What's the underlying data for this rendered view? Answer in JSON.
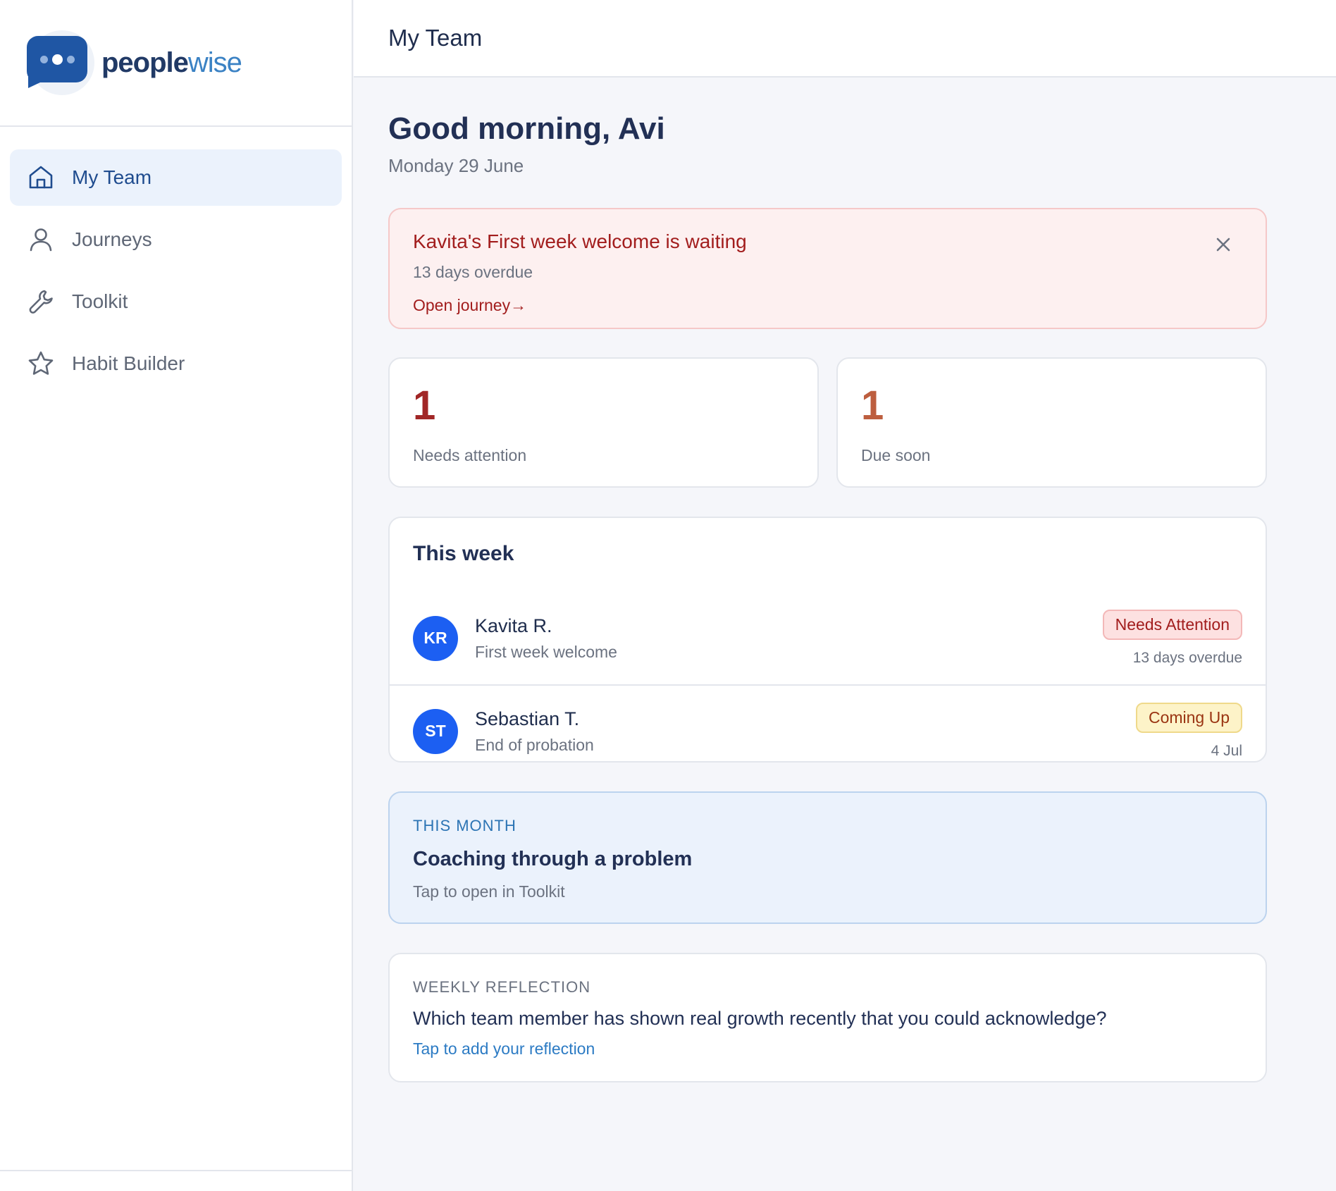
{
  "brand": {
    "name_part1": "people",
    "name_part2": "wise"
  },
  "sidebar": {
    "items": [
      {
        "label": "My Team",
        "icon": "home-icon",
        "active": true
      },
      {
        "label": "Journeys",
        "icon": "person-icon",
        "active": false
      },
      {
        "label": "Toolkit",
        "icon": "wrench-icon",
        "active": false
      },
      {
        "label": "Habit Builder",
        "icon": "star-icon",
        "active": false
      }
    ]
  },
  "header": {
    "title": "My Team"
  },
  "greeting": {
    "title": "Good morning, Avi",
    "date": "Monday 29 June"
  },
  "alert": {
    "title": "Kavita's First week welcome is waiting",
    "subtitle": "13 days overdue",
    "link": "Open journey→",
    "close_icon": "close-icon"
  },
  "stats": [
    {
      "value": "1",
      "label": "Needs attention",
      "color": "#a12626"
    },
    {
      "value": "1",
      "label": "Due soon",
      "color": "#bd5e3f"
    }
  ],
  "this_week": {
    "title": "This week",
    "rows": [
      {
        "initials": "KR",
        "name": "Kavita R.",
        "journey": "First week welcome",
        "badge": "Needs Attention",
        "meta": "13 days overdue"
      },
      {
        "initials": "ST",
        "name": "Sebastian T.",
        "journey": "End of probation",
        "badge": "Coming Up",
        "meta": "4 Jul"
      }
    ]
  },
  "this_month": {
    "kicker": "THIS MONTH",
    "title": "Coaching through a problem",
    "subtitle": "Tap to open in Toolkit"
  },
  "reflection": {
    "kicker": "WEEKLY REFLECTION",
    "question": "Which team member has shown real growth recently that you could acknowledge?",
    "link": "Tap to add your reflection"
  },
  "colors": {
    "accent": "#1f56a4",
    "avatar": "#1c5ff2",
    "danger": "#a21d1d"
  }
}
